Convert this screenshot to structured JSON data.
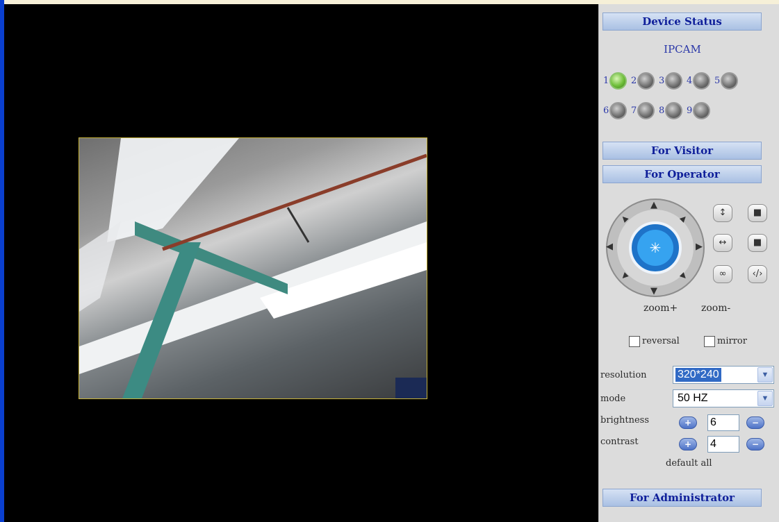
{
  "panel": {
    "device_status_title": "Device Status",
    "device_name": "IPCAM",
    "devices": [
      {
        "num": "1",
        "status": "online"
      },
      {
        "num": "2",
        "status": "offline"
      },
      {
        "num": "3",
        "status": "offline"
      },
      {
        "num": "4",
        "status": "offline"
      },
      {
        "num": "5",
        "status": "offline"
      },
      {
        "num": "6",
        "status": "offline"
      },
      {
        "num": "7",
        "status": "offline"
      },
      {
        "num": "8",
        "status": "offline"
      },
      {
        "num": "9",
        "status": "offline"
      }
    ],
    "for_visitor": "For Visitor",
    "for_operator": "For Operator",
    "for_administrator": "For Administrator"
  },
  "operator": {
    "zoom_in": "zoom+",
    "zoom_out": "zoom-",
    "reversal_label": "reversal",
    "reversal_checked": false,
    "mirror_label": "mirror",
    "mirror_checked": false,
    "resolution_label": "resolution",
    "resolution_value": "320*240",
    "mode_label": "mode",
    "mode_value": "50 HZ",
    "brightness_label": "brightness",
    "brightness_value": "6",
    "contrast_label": "contrast",
    "contrast_value": "4",
    "default_all": "default all",
    "plus_glyph": "+",
    "minus_glyph": "−"
  },
  "colors": {
    "accent_blue": "#1a2bb0",
    "led_online": "#6fbf3a",
    "led_offline": "#6d6d6d"
  }
}
